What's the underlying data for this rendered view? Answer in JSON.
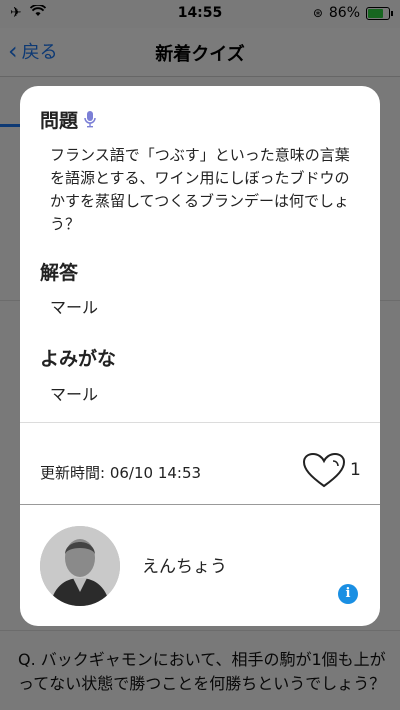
{
  "status_bar": {
    "time": "14:55",
    "battery_percent": "86%",
    "battery_level": 0.86
  },
  "nav": {
    "back_label": "戻る",
    "title": "新着クイズ"
  },
  "background": {
    "next_question": "Q. バックギャモンにおいて、相手の駒が1個も上がってない状態で勝つことを何勝ちというでしょう？"
  },
  "modal": {
    "question_heading": "問題",
    "question_text": "フランス語で「つぶす」といった意味の言葉を語源とする、ワイン用にしぼったブドウのかすを蒸留してつくるブランデーは何でしょう？",
    "answer_heading": "解答",
    "answer": "マール",
    "reading_heading": "よみがな",
    "reading": "マール",
    "updated_label": "更新時間: 06/10 14:53",
    "like_count": "1",
    "author": "えんちょう",
    "info_glyph": "i"
  },
  "colors": {
    "accent": "#1a73e8",
    "info": "#1a8fe3",
    "battery": "#2ecc40",
    "mic": "#7b7fd6"
  }
}
